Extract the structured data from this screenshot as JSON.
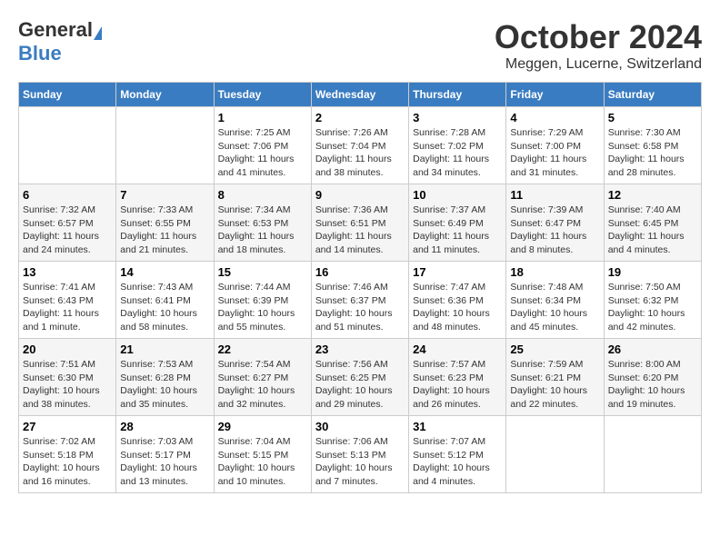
{
  "header": {
    "logo_general": "General",
    "logo_blue": "Blue",
    "month": "October 2024",
    "location": "Meggen, Lucerne, Switzerland"
  },
  "days_of_week": [
    "Sunday",
    "Monday",
    "Tuesday",
    "Wednesday",
    "Thursday",
    "Friday",
    "Saturday"
  ],
  "weeks": [
    [
      {
        "day": "",
        "sunrise": "",
        "sunset": "",
        "daylight": ""
      },
      {
        "day": "",
        "sunrise": "",
        "sunset": "",
        "daylight": ""
      },
      {
        "day": "1",
        "sunrise": "Sunrise: 7:25 AM",
        "sunset": "Sunset: 7:06 PM",
        "daylight": "Daylight: 11 hours and 41 minutes."
      },
      {
        "day": "2",
        "sunrise": "Sunrise: 7:26 AM",
        "sunset": "Sunset: 7:04 PM",
        "daylight": "Daylight: 11 hours and 38 minutes."
      },
      {
        "day": "3",
        "sunrise": "Sunrise: 7:28 AM",
        "sunset": "Sunset: 7:02 PM",
        "daylight": "Daylight: 11 hours and 34 minutes."
      },
      {
        "day": "4",
        "sunrise": "Sunrise: 7:29 AM",
        "sunset": "Sunset: 7:00 PM",
        "daylight": "Daylight: 11 hours and 31 minutes."
      },
      {
        "day": "5",
        "sunrise": "Sunrise: 7:30 AM",
        "sunset": "Sunset: 6:58 PM",
        "daylight": "Daylight: 11 hours and 28 minutes."
      }
    ],
    [
      {
        "day": "6",
        "sunrise": "Sunrise: 7:32 AM",
        "sunset": "Sunset: 6:57 PM",
        "daylight": "Daylight: 11 hours and 24 minutes."
      },
      {
        "day": "7",
        "sunrise": "Sunrise: 7:33 AM",
        "sunset": "Sunset: 6:55 PM",
        "daylight": "Daylight: 11 hours and 21 minutes."
      },
      {
        "day": "8",
        "sunrise": "Sunrise: 7:34 AM",
        "sunset": "Sunset: 6:53 PM",
        "daylight": "Daylight: 11 hours and 18 minutes."
      },
      {
        "day": "9",
        "sunrise": "Sunrise: 7:36 AM",
        "sunset": "Sunset: 6:51 PM",
        "daylight": "Daylight: 11 hours and 14 minutes."
      },
      {
        "day": "10",
        "sunrise": "Sunrise: 7:37 AM",
        "sunset": "Sunset: 6:49 PM",
        "daylight": "Daylight: 11 hours and 11 minutes."
      },
      {
        "day": "11",
        "sunrise": "Sunrise: 7:39 AM",
        "sunset": "Sunset: 6:47 PM",
        "daylight": "Daylight: 11 hours and 8 minutes."
      },
      {
        "day": "12",
        "sunrise": "Sunrise: 7:40 AM",
        "sunset": "Sunset: 6:45 PM",
        "daylight": "Daylight: 11 hours and 4 minutes."
      }
    ],
    [
      {
        "day": "13",
        "sunrise": "Sunrise: 7:41 AM",
        "sunset": "Sunset: 6:43 PM",
        "daylight": "Daylight: 11 hours and 1 minute."
      },
      {
        "day": "14",
        "sunrise": "Sunrise: 7:43 AM",
        "sunset": "Sunset: 6:41 PM",
        "daylight": "Daylight: 10 hours and 58 minutes."
      },
      {
        "day": "15",
        "sunrise": "Sunrise: 7:44 AM",
        "sunset": "Sunset: 6:39 PM",
        "daylight": "Daylight: 10 hours and 55 minutes."
      },
      {
        "day": "16",
        "sunrise": "Sunrise: 7:46 AM",
        "sunset": "Sunset: 6:37 PM",
        "daylight": "Daylight: 10 hours and 51 minutes."
      },
      {
        "day": "17",
        "sunrise": "Sunrise: 7:47 AM",
        "sunset": "Sunset: 6:36 PM",
        "daylight": "Daylight: 10 hours and 48 minutes."
      },
      {
        "day": "18",
        "sunrise": "Sunrise: 7:48 AM",
        "sunset": "Sunset: 6:34 PM",
        "daylight": "Daylight: 10 hours and 45 minutes."
      },
      {
        "day": "19",
        "sunrise": "Sunrise: 7:50 AM",
        "sunset": "Sunset: 6:32 PM",
        "daylight": "Daylight: 10 hours and 42 minutes."
      }
    ],
    [
      {
        "day": "20",
        "sunrise": "Sunrise: 7:51 AM",
        "sunset": "Sunset: 6:30 PM",
        "daylight": "Daylight: 10 hours and 38 minutes."
      },
      {
        "day": "21",
        "sunrise": "Sunrise: 7:53 AM",
        "sunset": "Sunset: 6:28 PM",
        "daylight": "Daylight: 10 hours and 35 minutes."
      },
      {
        "day": "22",
        "sunrise": "Sunrise: 7:54 AM",
        "sunset": "Sunset: 6:27 PM",
        "daylight": "Daylight: 10 hours and 32 minutes."
      },
      {
        "day": "23",
        "sunrise": "Sunrise: 7:56 AM",
        "sunset": "Sunset: 6:25 PM",
        "daylight": "Daylight: 10 hours and 29 minutes."
      },
      {
        "day": "24",
        "sunrise": "Sunrise: 7:57 AM",
        "sunset": "Sunset: 6:23 PM",
        "daylight": "Daylight: 10 hours and 26 minutes."
      },
      {
        "day": "25",
        "sunrise": "Sunrise: 7:59 AM",
        "sunset": "Sunset: 6:21 PM",
        "daylight": "Daylight: 10 hours and 22 minutes."
      },
      {
        "day": "26",
        "sunrise": "Sunrise: 8:00 AM",
        "sunset": "Sunset: 6:20 PM",
        "daylight": "Daylight: 10 hours and 19 minutes."
      }
    ],
    [
      {
        "day": "27",
        "sunrise": "Sunrise: 7:02 AM",
        "sunset": "Sunset: 5:18 PM",
        "daylight": "Daylight: 10 hours and 16 minutes."
      },
      {
        "day": "28",
        "sunrise": "Sunrise: 7:03 AM",
        "sunset": "Sunset: 5:17 PM",
        "daylight": "Daylight: 10 hours and 13 minutes."
      },
      {
        "day": "29",
        "sunrise": "Sunrise: 7:04 AM",
        "sunset": "Sunset: 5:15 PM",
        "daylight": "Daylight: 10 hours and 10 minutes."
      },
      {
        "day": "30",
        "sunrise": "Sunrise: 7:06 AM",
        "sunset": "Sunset: 5:13 PM",
        "daylight": "Daylight: 10 hours and 7 minutes."
      },
      {
        "day": "31",
        "sunrise": "Sunrise: 7:07 AM",
        "sunset": "Sunset: 5:12 PM",
        "daylight": "Daylight: 10 hours and 4 minutes."
      },
      {
        "day": "",
        "sunrise": "",
        "sunset": "",
        "daylight": ""
      },
      {
        "day": "",
        "sunrise": "",
        "sunset": "",
        "daylight": ""
      }
    ]
  ]
}
